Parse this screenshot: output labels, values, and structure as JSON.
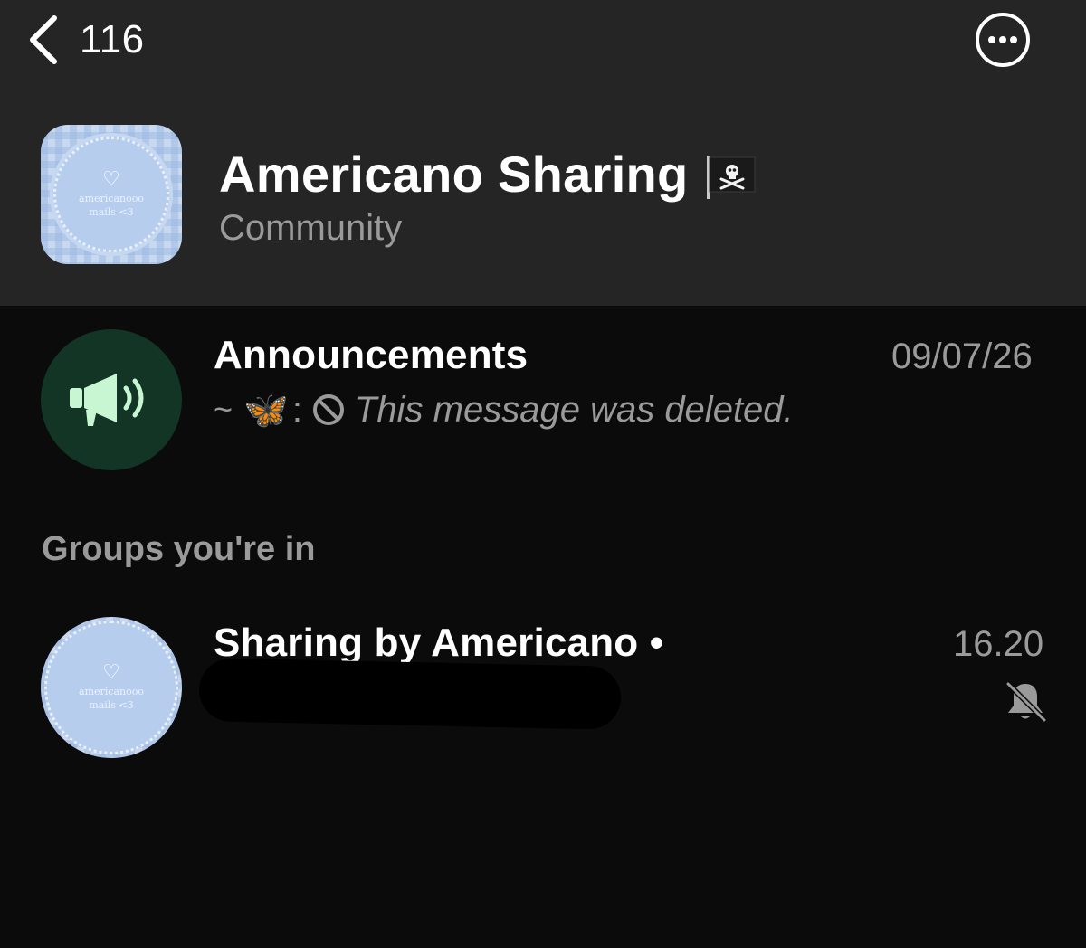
{
  "nav": {
    "back_count": "116"
  },
  "community": {
    "name": "Americano Sharing",
    "subtitle": "Community",
    "flag_icon": "pirate-flag-icon",
    "avatar": {
      "line1": "americanooo",
      "line2": "mails <3"
    }
  },
  "announcements": {
    "title": "Announcements",
    "time": "09/07/26",
    "preview_prefix": "~",
    "preview_emoji": "🦋",
    "preview_separator": ":",
    "preview_text": "This message was deleted.",
    "icon": "megaphone-icon"
  },
  "groups_section": {
    "label": "Groups you're in"
  },
  "groups": [
    {
      "title": "Sharing by Americano •",
      "time": "16.20",
      "muted": true,
      "avatar": {
        "line1": "americanooo",
        "line2": "mails <3"
      }
    }
  ],
  "colors": {
    "header_bg": "#252525",
    "page_bg": "#0b0b0b",
    "announce_avatar_bg": "#123526",
    "announce_icon": "#c8f5d2",
    "muted_text": "#9a9a9a"
  }
}
